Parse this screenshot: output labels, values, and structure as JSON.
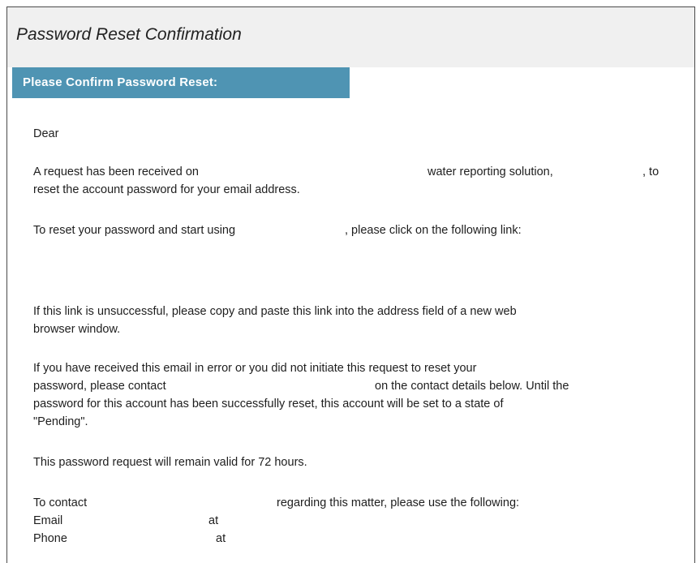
{
  "email": {
    "header_title": "Password Reset Confirmation",
    "section_title": "Please Confirm Password Reset:",
    "greeting": "Dear",
    "request_line1_a": "A request has been received on",
    "request_line1_b": "water reporting solution,",
    "request_line1_c": ", to",
    "request_line2": "reset the account password for your email address.",
    "reset_prompt_a": "To reset your password and start using",
    "reset_prompt_b": ", please click on the following link:",
    "fallback_line1": "If this link is unsuccessful, please copy and paste this link into the address field of a new web",
    "fallback_line2": "browser window.",
    "error_line1": "If you have received this email in error or you did not initiate this request to reset your",
    "error_line2_a": "password, please contact",
    "error_line2_b": "on the contact details below. Until the",
    "error_line3": "password for this account has been successfully reset, this account will be set to a state of",
    "error_line4": "\"Pending\".",
    "validity": "This password request will remain valid for 72 hours.",
    "contact_a": "To contact",
    "contact_b": "regarding this matter, please use the following:",
    "email_label": "Email",
    "email_at": "at",
    "phone_label": "Phone",
    "phone_at": "at"
  }
}
